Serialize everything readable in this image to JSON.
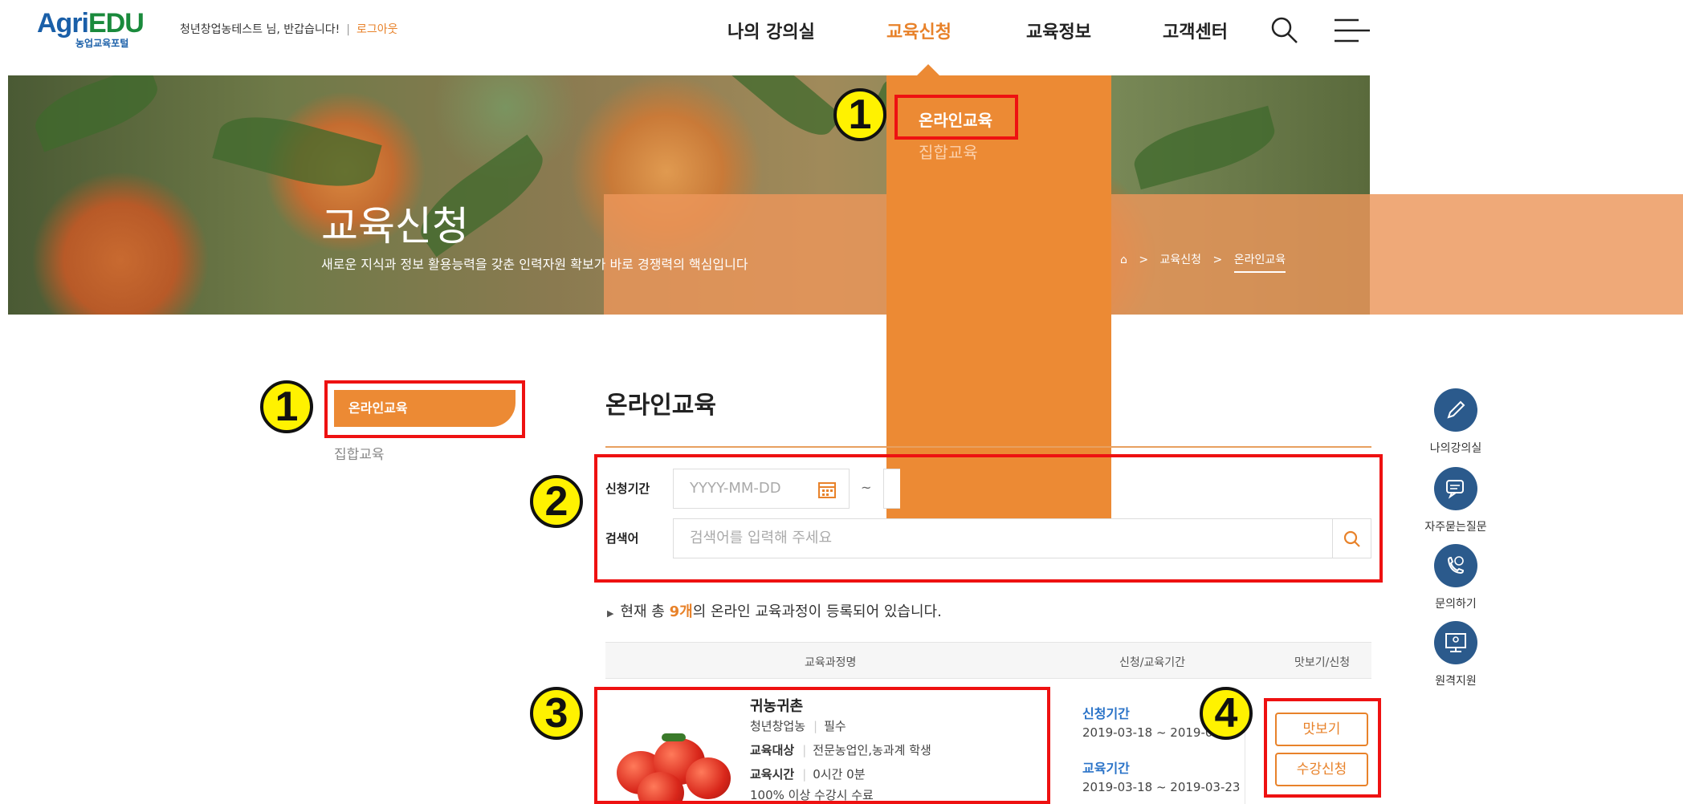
{
  "header": {
    "logo_main_a": "Agri",
    "logo_main_b": "EDU",
    "logo_sub": "농업교육포털",
    "greeting": "청년창업농테스트 님, 반갑습니다!",
    "separator": "|",
    "logout": "로그아웃",
    "nav": [
      "나의 강의실",
      "교육신청",
      "교육정보",
      "고객센터"
    ],
    "search_icon": "search-icon",
    "menu_icon": "hamburger-menu-icon"
  },
  "dropdown": {
    "items": [
      "온라인교육",
      "집합교육"
    ]
  },
  "banner": {
    "title": "교육신청",
    "subtitle": "새로운 지식과 정보 활용능력을 갖춘 인력자원 확보가 바로 경쟁력의 핵심입니다",
    "breadcrumb": [
      "교육신청",
      "온라인교육"
    ]
  },
  "side_nav": {
    "items": [
      "온라인교육",
      "집합교육"
    ]
  },
  "main": {
    "title": "온라인교육",
    "search": {
      "period_label": "신청기간",
      "date_placeholder": "YYYY-MM-DD",
      "tilde": "~",
      "keyword_label": "검색어",
      "keyword_placeholder": "검색어를 입력해 주세요"
    },
    "result_pre": "현재 총 ",
    "result_count": "9개",
    "result_post": "의 온라인 교육과정이 등록되어 있습니다.",
    "table_headers": [
      "교육과정명",
      "신청/교육기간",
      "맛보기/신청"
    ],
    "course": {
      "name": "귀농귀촌",
      "category": "청년창업농",
      "required": "필수",
      "target_label": "교육대상",
      "target": "전문농업인,농과계 학생",
      "time_label": "교육시간",
      "time": "0시간 0분",
      "completion": "100% 이상 수강시 수료",
      "apply_label": "신청기간",
      "apply_period": "2019-03-18 ~ 2019-03-23",
      "edu_label": "교육기간",
      "edu_period": "2019-03-18 ~ 2019-03-23",
      "preview_button": "맛보기",
      "enroll_button": "수강신청"
    }
  },
  "quick_menu": [
    "나의강의실",
    "자주묻는질문",
    "문의하기",
    "원격지원"
  ],
  "annotations": [
    "1",
    "1",
    "2",
    "3",
    "4"
  ],
  "colors": {
    "accent": "#ec8a34",
    "brand_blue": "#1a5fa8",
    "annotation_red": "#ee1111",
    "annotation_yellow": "#fff200",
    "quick_blue": "#2b5a8c"
  }
}
